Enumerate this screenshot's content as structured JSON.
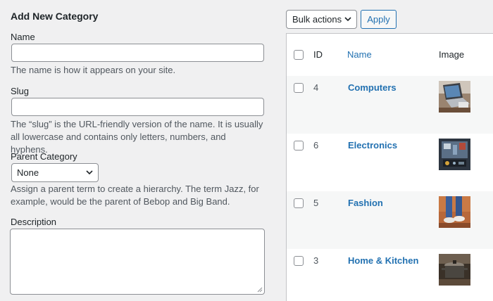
{
  "form": {
    "title": "Add New Category",
    "name_label": "Name",
    "name_value": "",
    "name_help": "The name is how it appears on your site.",
    "slug_label": "Slug",
    "slug_value": "",
    "slug_help": "The “slug” is the URL-friendly version of the name. It is usually all lowercase and contains only letters, numbers, and hyphens.",
    "parent_label": "Parent Category",
    "parent_value": "None",
    "parent_help": "Assign a parent term to create a hierarchy. The term Jazz, for example, would be the parent of Bebop and Big Band.",
    "description_label": "Description",
    "description_value": ""
  },
  "toolbar": {
    "bulk_actions": "Bulk actions",
    "apply": "Apply"
  },
  "table": {
    "columns": {
      "id": "ID",
      "name": "Name",
      "image": "Image"
    },
    "rows": [
      {
        "id": "4",
        "name": "Computers",
        "image": "laptop-thumbnail"
      },
      {
        "id": "6",
        "name": "Electronics",
        "image": "electronics-thumbnail"
      },
      {
        "id": "5",
        "name": "Fashion",
        "image": "shoes-thumbnail"
      },
      {
        "id": "3",
        "name": "Home & Kitchen",
        "image": "cooking-pot-thumbnail"
      }
    ]
  },
  "colors": {
    "background": "#f0f0f1",
    "link": "#2271b1",
    "border": "#8c8f94",
    "row_alt": "#f6f7f7"
  }
}
